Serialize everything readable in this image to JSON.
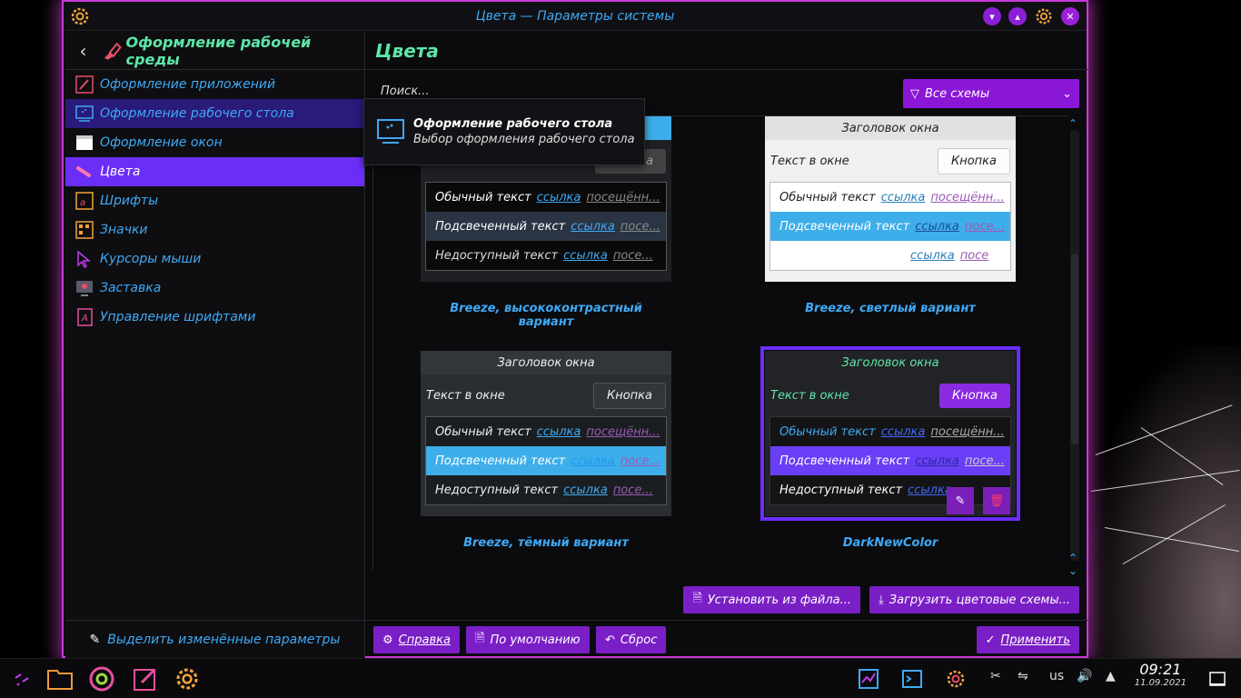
{
  "window": {
    "title": "Цвета — Параметры системы"
  },
  "sidebar": {
    "header": "Оформление рабочей среды",
    "items": [
      {
        "label": "Оформление приложений",
        "icon": "paint-brush-icon"
      },
      {
        "label": "Оформление рабочего стола",
        "icon": "desktop-theme-icon"
      },
      {
        "label": "Оформление окон",
        "icon": "window-icon"
      },
      {
        "label": "Цвета",
        "icon": "color-brush-icon"
      },
      {
        "label": "Шрифты",
        "icon": "fonts-icon"
      },
      {
        "label": "Значки",
        "icon": "icons-icon"
      },
      {
        "label": "Курсоры мыши",
        "icon": "cursor-icon"
      },
      {
        "label": "Заставка",
        "icon": "splash-icon"
      },
      {
        "label": "Управление шрифтами",
        "icon": "font-manager-icon"
      }
    ],
    "footer": "Выделить изменённые параметры"
  },
  "main": {
    "title": "Цвета",
    "search_placeholder": "Поиск...",
    "filter": "Все схемы",
    "install_file": "Установить из файла...",
    "download": "Загрузить цветовые схемы...",
    "help": "Справка",
    "defaults": "По умолчанию",
    "reset": "Сброс",
    "apply": "Применить"
  },
  "tooltip": {
    "title": "Оформление рабочего стола",
    "subtitle": "Выбор оформления рабочего стола"
  },
  "preview_text": {
    "window_title": "Заголовок окна",
    "window_text": "Текст в окне",
    "button": "Кнопка",
    "normal": "Обычный текст",
    "link": "ссылка",
    "visited": "посещённ...",
    "visited_full": "посещённ...",
    "highlighted": "Подсвеченный текст",
    "visited_short": "посе...",
    "visited_bare": "посе",
    "disabled": "Недоступный текст"
  },
  "schemes": [
    {
      "name": "Breeze, высококонтрастный вариант"
    },
    {
      "name": "Breeze, светлый вариант"
    },
    {
      "name": "Breeze, тёмный вариант"
    },
    {
      "name": "DarkNewColor"
    }
  ],
  "tray": {
    "lang": "us",
    "time": "09:21",
    "date": "11.09.2021"
  },
  "colors": {
    "accent": "#6a2ef7",
    "button_purple": "#7a1ec6",
    "link_blue": "#3fa9f5",
    "heading_green": "#5de6a8"
  }
}
